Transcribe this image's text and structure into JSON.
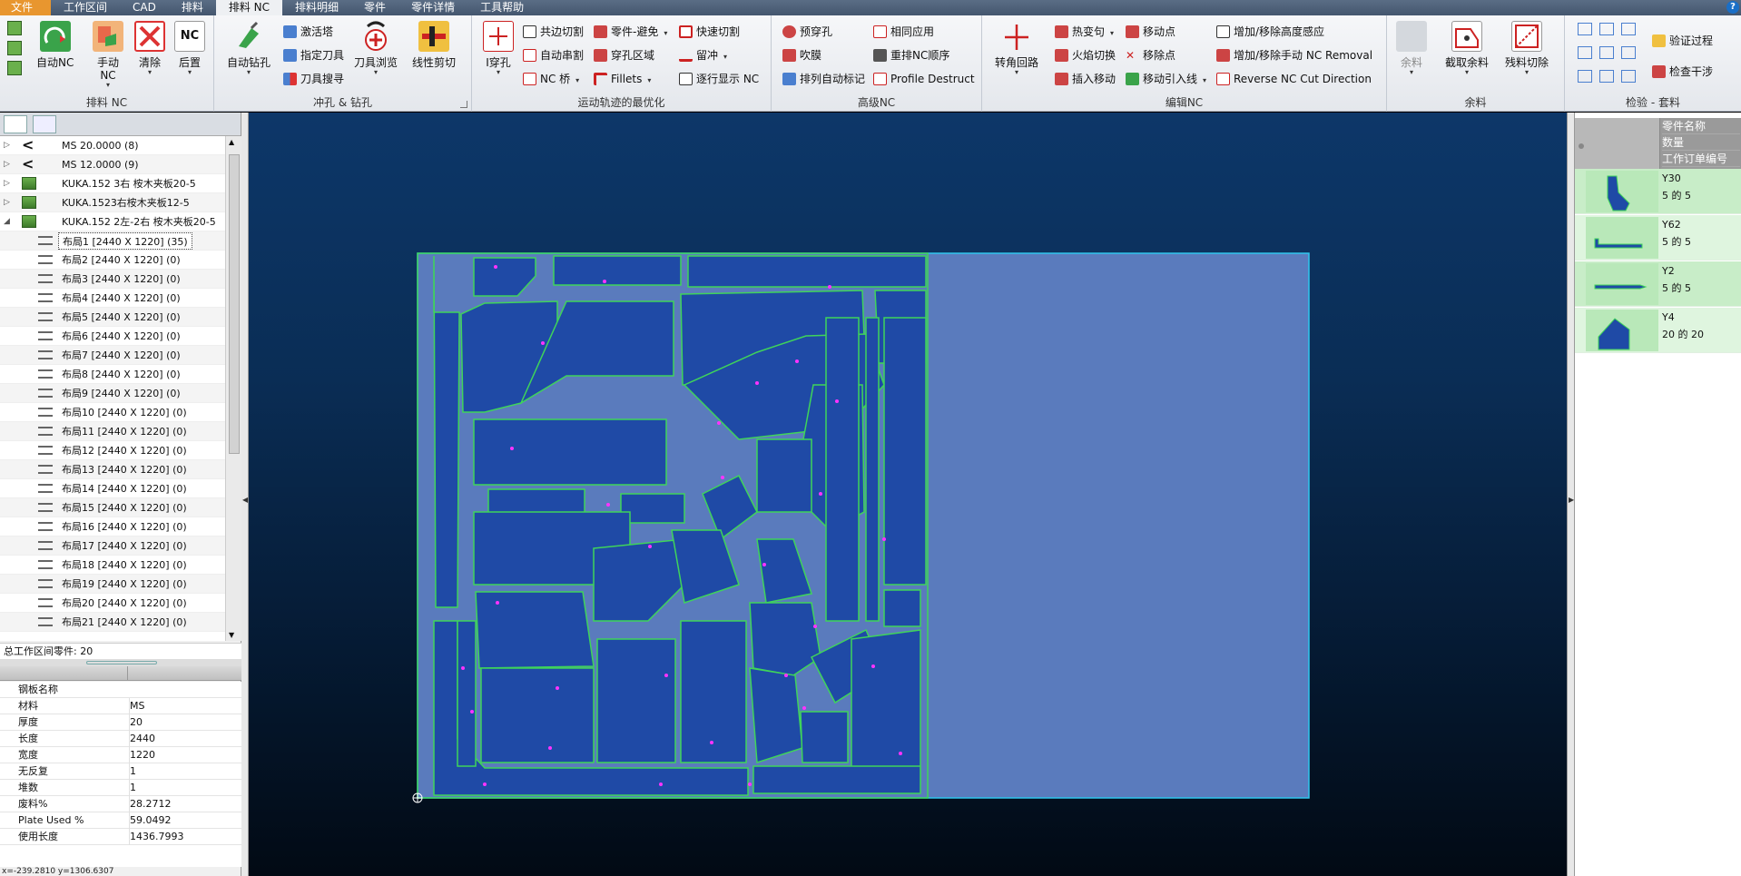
{
  "menu": {
    "file": "文件",
    "tabs": [
      "工作区间",
      "CAD",
      "排料",
      "排料 NC",
      "排料明细",
      "零件",
      "零件详情",
      "工具帮助"
    ],
    "active_index": 3,
    "help": "?"
  },
  "ribbon": {
    "groups": {
      "nesting_nc": "排料 NC",
      "punch_drill": "冲孔 & 钻孔",
      "motion_opt": "运动轨迹的最优化",
      "advanced_nc": "高级NC",
      "edit_nc": "编辑NC",
      "remnant": "余料",
      "check": "检验 - 套料"
    },
    "buttons": {
      "auto_nc": "自动NC",
      "manual_nc": "手动\nNC",
      "clear": "清除",
      "post": "后置",
      "auto_drill": "自动钻孔",
      "activate_tower": "激活塔",
      "assign_tool": "指定刀具",
      "tool_search": "刀具搜寻",
      "tool_browse": "刀具浏览",
      "linear_cut": "线性剪切",
      "pierce": "I穿孔",
      "common_cut": "共边切割",
      "auto_chain": "自动串割",
      "nc_bridge": "NC 桥",
      "part_avoid": "零件-避免",
      "pierce_area": "穿孔区域",
      "fillets": "Fillets",
      "quick_cut": "快速切割",
      "tab": "留冲",
      "step_display": "逐行显示 NC",
      "pre_pierce": "预穿孔",
      "blow": "吹膜",
      "auto_mark": "排列自动标记",
      "same_apply": "相同应用",
      "reorder_nc": "重排NC顺序",
      "profile_destruct": "Profile Destruct",
      "corner_loop": "转角回路",
      "hot_change": "热变句",
      "flame_cut": "火焰切换",
      "insert_move": "插入移动",
      "move_point": "移动点",
      "remove_point": "移除点",
      "move_leadin": "移动引入线",
      "height_sense": "增加/移除高度感应",
      "manual_nc_removal": "增加/移除手动 NC Removal",
      "reverse_nc": "Reverse NC Cut Direction",
      "remnant": "余料",
      "cut_remnant": "截取余料",
      "scrap_cut": "残料切除",
      "verify_process": "验证过程",
      "check_interference": "检查干涉"
    }
  },
  "tree": {
    "rows": [
      {
        "label": "MS 20.0000 (8)",
        "icon": "chevron-icon",
        "level": 0
      },
      {
        "label": "MS 12.0000 (9)",
        "icon": "chevron-icon",
        "level": 0
      },
      {
        "label": "KUKA.152 3右 桉木夹板20-5",
        "icon": "sheet-icon",
        "level": 0
      },
      {
        "label": "KUKA.1523右桉木夹板12-5",
        "icon": "sheet-icon",
        "level": 0
      },
      {
        "label": "KUKA.152 2左-2右 桉木夹板20-5",
        "icon": "sheet-icon",
        "level": 0
      },
      {
        "label": "布局1 [2440 X 1220]  (35)",
        "icon": "layer-icon",
        "level": 1
      },
      {
        "label": "布局2 [2440 X 1220]  (0)",
        "icon": "layer-icon",
        "level": 1
      },
      {
        "label": "布局3 [2440 X 1220]  (0)",
        "icon": "layer-icon",
        "level": 1
      },
      {
        "label": "布局4 [2440 X 1220]  (0)",
        "icon": "layer-icon",
        "level": 1
      },
      {
        "label": "布局5 [2440 X 1220]  (0)",
        "icon": "layer-icon",
        "level": 1
      },
      {
        "label": "布局6 [2440 X 1220]  (0)",
        "icon": "layer-icon",
        "level": 1
      },
      {
        "label": "布局7 [2440 X 1220]  (0)",
        "icon": "layer-icon",
        "level": 1
      },
      {
        "label": "布局8 [2440 X 1220]  (0)",
        "icon": "layer-icon",
        "level": 1
      },
      {
        "label": "布局9 [2440 X 1220]  (0)",
        "icon": "layer-icon",
        "level": 1
      },
      {
        "label": "布局10 [2440 X 1220]  (0)",
        "icon": "layer-icon",
        "level": 1
      },
      {
        "label": "布局11 [2440 X 1220]  (0)",
        "icon": "layer-icon",
        "level": 1
      },
      {
        "label": "布局12 [2440 X 1220]  (0)",
        "icon": "layer-icon",
        "level": 1
      },
      {
        "label": "布局13 [2440 X 1220]  (0)",
        "icon": "layer-icon",
        "level": 1
      },
      {
        "label": "布局14 [2440 X 1220]  (0)",
        "icon": "layer-icon",
        "level": 1
      },
      {
        "label": "布局15 [2440 X 1220]  (0)",
        "icon": "layer-icon",
        "level": 1
      },
      {
        "label": "布局16 [2440 X 1220]  (0)",
        "icon": "layer-icon",
        "level": 1
      },
      {
        "label": "布局17 [2440 X 1220]  (0)",
        "icon": "layer-icon",
        "level": 1
      },
      {
        "label": "布局18 [2440 X 1220]  (0)",
        "icon": "layer-icon",
        "level": 1
      },
      {
        "label": "布局19 [2440 X 1220]  (0)",
        "icon": "layer-icon",
        "level": 1
      },
      {
        "label": "布局20 [2440 X 1220]  (0)",
        "icon": "layer-icon",
        "level": 1
      },
      {
        "label": "布局21 [2440 X 1220]  (0)",
        "icon": "layer-icon",
        "level": 1
      }
    ],
    "selected_index": 5
  },
  "total_parts": "总工作区间零件: 20",
  "properties": [
    {
      "key": "钢板名称",
      "value": ""
    },
    {
      "key": "材料",
      "value": "MS"
    },
    {
      "key": "厚度",
      "value": "20"
    },
    {
      "key": "长度",
      "value": "2440"
    },
    {
      "key": "宽度",
      "value": "1220"
    },
    {
      "key": "无反复",
      "value": "1"
    },
    {
      "key": "堆数",
      "value": "1"
    },
    {
      "key": "废料%",
      "value": "28.2712"
    },
    {
      "key": "Plate Used %",
      "value": "59.0492"
    },
    {
      "key": "使用长度",
      "value": "1436.7993"
    }
  ],
  "status_coords": "x=-239.2810 y=1306.6307",
  "parts_panel": {
    "headers": [
      "零件名称",
      "数量",
      "工作订单编号"
    ],
    "parts": [
      {
        "name": "Y30",
        "qty": "5 的 5"
      },
      {
        "name": "Y62",
        "qty": "5 的 5"
      },
      {
        "name": "Y2",
        "qty": "5 的 5"
      },
      {
        "name": "Y4",
        "qty": "20 的 20"
      }
    ]
  },
  "colors": {
    "sheet_fill": "#5a7bbd",
    "part_fill": "#1f4aa6",
    "part_stroke": "#3fd45a",
    "pierce_dot": "#ff33ff",
    "sheet_border": "#2fc6ee"
  }
}
